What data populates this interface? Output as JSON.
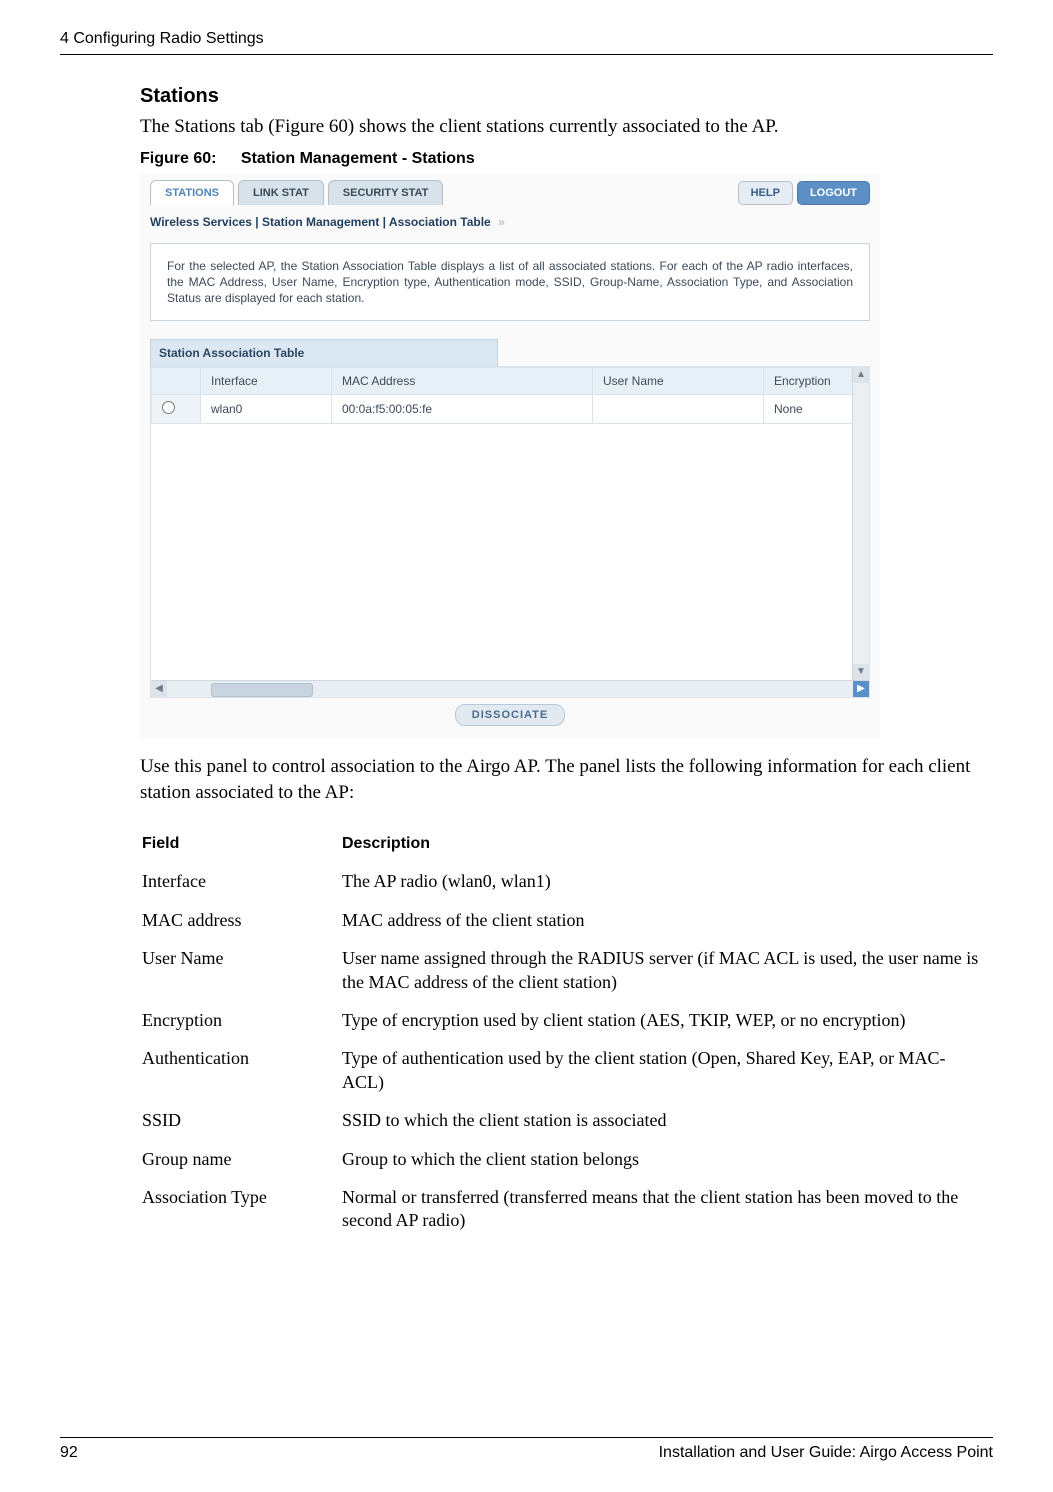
{
  "header": {
    "chapter": "4  Configuring Radio Settings"
  },
  "section": {
    "heading": "Stations",
    "intro": "The Stations tab (Figure 60) shows the client stations currently associated to the AP.",
    "fig_label": "Figure 60:",
    "fig_title": "Station Management - Stations"
  },
  "ui": {
    "tabs": {
      "stations": "STATIONS",
      "link_stat": "LINK STAT",
      "security_stat": "SECURITY STAT"
    },
    "buttons": {
      "help": "HELP",
      "logout": "LOGOUT",
      "dissociate": "DISSOCIATE"
    },
    "breadcrumb": "Wireless Services | Station Management | Association Table",
    "info_text": "For the selected AP, the Station Association Table displays a list of all associated stations. For each of the AP radio interfaces, the MAC Address, User Name, Encryption type, Authentication mode, SSID, Group-Name, Association Type, and Association Status are displayed for each station.",
    "sat_title": "Station Association Table",
    "sat_headers": {
      "interface": "Interface",
      "mac": "MAC Address",
      "user": "User Name",
      "encryption": "Encryption"
    },
    "sat_rows": [
      {
        "interface": "wlan0",
        "mac": "00:0a:f5:00:05:fe",
        "user": "",
        "encryption": "None"
      }
    ]
  },
  "post_text": "Use this panel to control association to the Airgo AP. The panel lists the following information for each client station associated to the AP:",
  "field_table": {
    "head": {
      "field": "Field",
      "desc": "Description"
    },
    "rows": [
      {
        "field": "Interface",
        "desc": "The AP radio (wlan0, wlan1)"
      },
      {
        "field": "MAC address",
        "desc": "MAC address of the client station"
      },
      {
        "field": "User Name",
        "desc": "User name assigned through the RADIUS server (if MAC ACL is used, the user name is the MAC address of the client station)"
      },
      {
        "field": "Encryption",
        "desc": "Type of encryption used by client station (AES, TKIP, WEP, or no encryption)"
      },
      {
        "field": "Authentication",
        "desc": "Type of authentication used by the client station (Open, Shared Key, EAP, or MAC-ACL)"
      },
      {
        "field": "SSID",
        "desc": "SSID to which the client station is associated"
      },
      {
        "field": "Group name",
        "desc": "Group to which the client station belongs"
      },
      {
        "field": "Association Type",
        "desc": "Normal or transferred (transferred means that the client station has been moved to the second AP radio)"
      }
    ]
  },
  "footer": {
    "page_num": "92",
    "doc_title": "Installation and User Guide: Airgo Access Point"
  }
}
